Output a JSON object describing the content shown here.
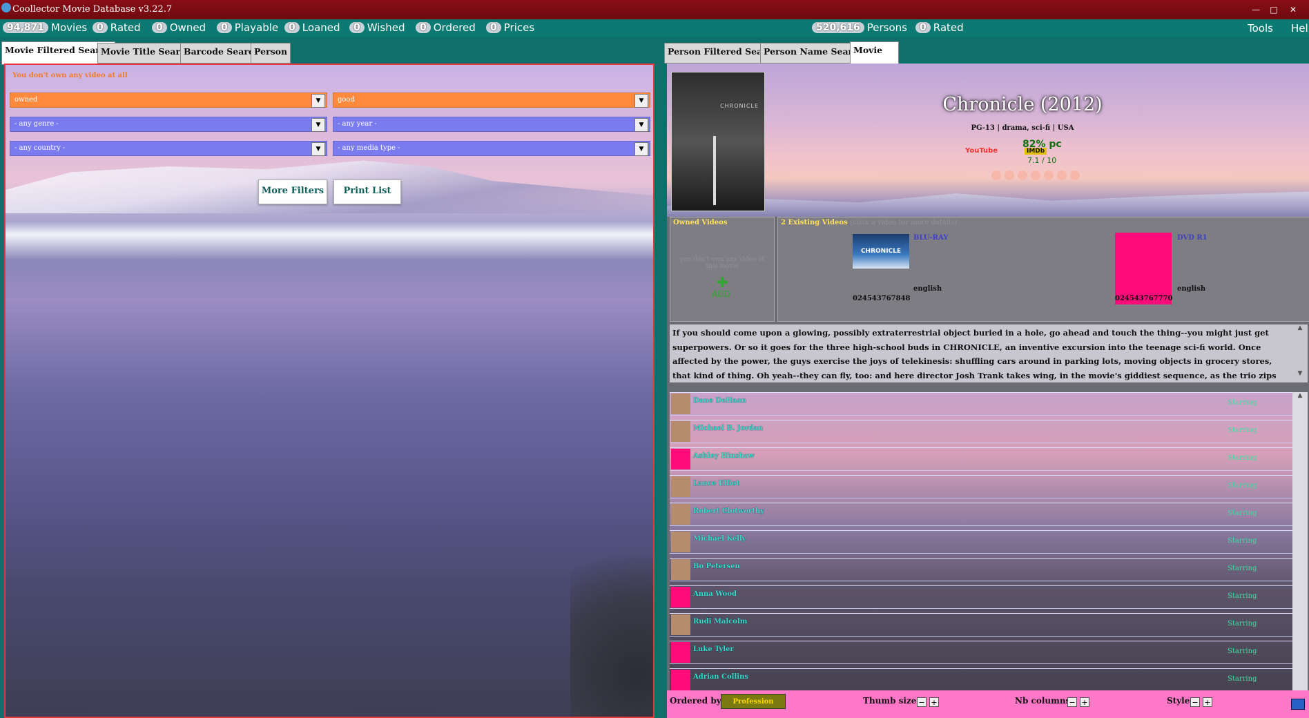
{
  "window": {
    "title": "Coollector Movie Database  v3.22.7",
    "minimize": "—",
    "maximize": "□",
    "close": "✕"
  },
  "stats": {
    "movies": {
      "count": "94,871",
      "label": "Movies"
    },
    "rated": {
      "count": "0",
      "label": "Rated"
    },
    "owned": {
      "count": "0",
      "label": "Owned"
    },
    "playable": {
      "count": "0",
      "label": "Playable"
    },
    "loaned": {
      "count": "0",
      "label": "Loaned"
    },
    "wished": {
      "count": "0",
      "label": "Wished"
    },
    "ordered": {
      "count": "0",
      "label": "Ordered"
    },
    "prices": {
      "count": "0",
      "label": "Prices"
    },
    "persons": {
      "count": "520,616",
      "label": "Persons"
    },
    "persons_rated": {
      "count": "0",
      "label": "Rated"
    },
    "tools": "Tools",
    "help": "Help"
  },
  "left_tabs": [
    "Movie Filtered Search",
    "Movie Title Search",
    "Barcode Search",
    "Person"
  ],
  "filters": {
    "warning": "You don't own any video at all",
    "owned": "owned",
    "quality": "good",
    "genre": "- any genre -",
    "year": "- any year -",
    "country": "- any country -",
    "media_type": "- any media type -",
    "dropdown_arrow": "▼",
    "more_filters": "More Filters",
    "print_list": "Print List"
  },
  "right_tabs": [
    "Person Filtered Search",
    "Person Name Search",
    "Movie"
  ],
  "movie": {
    "poster_text": "CHRONICLE",
    "title": "Chronicle (2012)",
    "subtitle": "PG-13 | drama, sci-fi | USA",
    "youtube": "YouTube",
    "imdb_percent": "82% pc",
    "imdb_badge": "IMDb",
    "imdb_score": "7.1 / 10",
    "owned_header": "Owned Videos",
    "owned_note": "you don't own any video of this movie",
    "add_plus": "✚",
    "add_label": "ADD",
    "existing_header": "2  Existing Videos",
    "existing_note": "(click a video for more details)",
    "videos": [
      {
        "format": "BLU-RAY",
        "cover_text": "CHRONICLE",
        "language": "english",
        "barcode": "024543767848"
      },
      {
        "format": "DVD R1",
        "cover_text": "",
        "language": "english",
        "barcode": "024543767770"
      }
    ],
    "synopsis": "If you should come upon a glowing, possibly extraterrestrial object buried in a hole, go ahead and touch the thing--you might just get superpowers. Or so it goes for the three high-school buds in CHRONICLE, an inventive excursion into the teenage sci-fi world. Once affected by the power, the guys exercise the joys of telekinesis: shuffling cars around in parking lots, moving objects in grocery stores, that kind of thing. Oh yeah--they can fly, too: and here director Josh Trank takes wing, in the movie's giddiest sequence, as the trio zips around the clouds in a glorious wish-fulfillment. It goes without saying that there will be a shadow",
    "scroll_up": "▲",
    "scroll_down": "▼"
  },
  "cast": [
    {
      "name": "Dane DeHaan",
      "role": "Starring",
      "thumb": "photo"
    },
    {
      "name": "Michael B. Jordan",
      "role": "Starring",
      "thumb": "photo"
    },
    {
      "name": "Ashley Hinshaw",
      "role": "Starring",
      "thumb": "placeholder"
    },
    {
      "name": "Lance Elliot",
      "role": "Starring",
      "thumb": "photo"
    },
    {
      "name": "Robert Clotworthy",
      "role": "Starring",
      "thumb": "photo"
    },
    {
      "name": "Michael Kelly",
      "role": "Starring",
      "thumb": "photo"
    },
    {
      "name": "Bo Petersen",
      "role": "Starring",
      "thumb": "photo"
    },
    {
      "name": "Anna Wood",
      "role": "Starring",
      "thumb": "placeholder"
    },
    {
      "name": "Rudi Malcolm",
      "role": "Starring",
      "thumb": "photo"
    },
    {
      "name": "Luke Tyler",
      "role": "Starring",
      "thumb": "placeholder"
    },
    {
      "name": "Adrian Collins",
      "role": "Starring",
      "thumb": "placeholder"
    }
  ],
  "bottom": {
    "ordered_by_label": "Ordered by:",
    "ordered_by_value": "Profession",
    "thumb_size_label": "Thumb size:",
    "nb_columns_label": "Nb columns:",
    "style_label": "Style:",
    "minus": "−",
    "plus": "+"
  },
  "colors": {
    "teal": "#0a7a73",
    "titlebar": "#8a0d15",
    "orange": "#ff8a3d",
    "blue": "#7b7bf0",
    "pink": "#ff0c7a",
    "cast_name": "#38e0c8"
  }
}
